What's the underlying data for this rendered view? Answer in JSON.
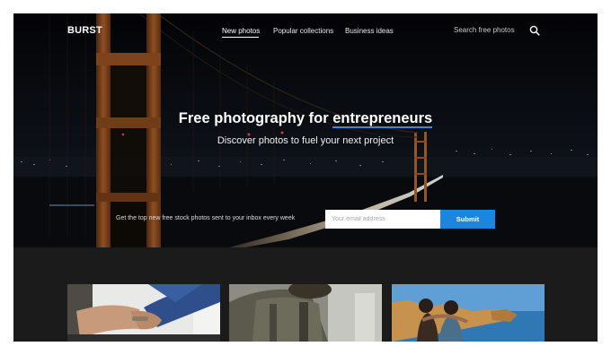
{
  "nav": {
    "logo": "BURST",
    "links": [
      {
        "label": "New photos",
        "active": true
      },
      {
        "label": "Popular collections",
        "active": false
      },
      {
        "label": "Business ideas",
        "active": false
      }
    ],
    "search_placeholder": "Search free photos",
    "search_icon": "search-icon"
  },
  "hero": {
    "headline_prefix": "Free photography for ",
    "headline_accent": "entrepreneurs",
    "subheadline": "Discover photos to fuel your next project",
    "signup_text": "Get the top new free stock photos sent to your inbox every week",
    "email_placeholder": "Your email address",
    "submit_label": "Submit"
  },
  "colors": {
    "accent": "#1a86e0",
    "section_background": "#1b1b1b"
  }
}
